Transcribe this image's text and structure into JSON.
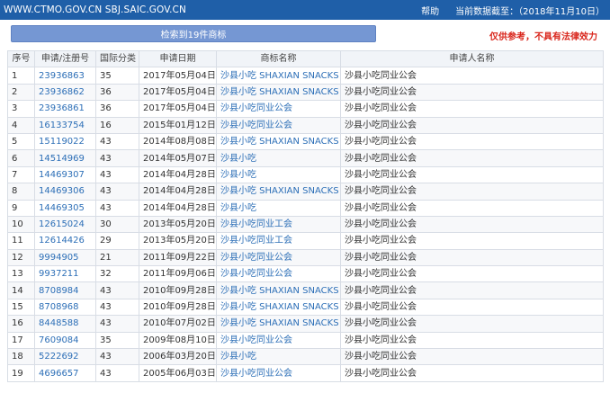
{
  "topbar": {
    "sites": "WWW.CTMO.GOV.CN SBJ.SAIC.GOV.CN",
    "help": "帮助",
    "data_date": "当前数据截至：（2018年11月10日）"
  },
  "toolbar": {
    "result_label": "检索到19件商标",
    "disclaimer": "仅供参考，不具有法律效力"
  },
  "table": {
    "headers": [
      "序号",
      "申请/注册号",
      "国际分类",
      "申请日期",
      "商标名称",
      "申请人名称"
    ],
    "rows": [
      {
        "idx": "1",
        "reg": "23936863",
        "cls": "35",
        "date": "2017年05月04日",
        "name": "沙县小吃 SHAXIAN SNACKS",
        "app": "沙县小吃同业公会"
      },
      {
        "idx": "2",
        "reg": "23936862",
        "cls": "36",
        "date": "2017年05月04日",
        "name": "沙县小吃 SHAXIAN SNACKS",
        "app": "沙县小吃同业公会"
      },
      {
        "idx": "3",
        "reg": "23936861",
        "cls": "36",
        "date": "2017年05月04日",
        "name": "沙县小吃同业公会",
        "app": "沙县小吃同业公会"
      },
      {
        "idx": "4",
        "reg": "16133754",
        "cls": "16",
        "date": "2015年01月12日",
        "name": "沙县小吃同业公会",
        "app": "沙县小吃同业公会"
      },
      {
        "idx": "5",
        "reg": "15119022",
        "cls": "43",
        "date": "2014年08月08日",
        "name": "沙县小吃 SHAXIAN SNACKS",
        "app": "沙县小吃同业公会"
      },
      {
        "idx": "6",
        "reg": "14514969",
        "cls": "43",
        "date": "2014年05月07日",
        "name": "沙县小吃",
        "app": "沙县小吃同业公会"
      },
      {
        "idx": "7",
        "reg": "14469307",
        "cls": "43",
        "date": "2014年04月28日",
        "name": "沙县小吃",
        "app": "沙县小吃同业公会"
      },
      {
        "idx": "8",
        "reg": "14469306",
        "cls": "43",
        "date": "2014年04月28日",
        "name": "沙县小吃 SHAXIAN SNACKS",
        "app": "沙县小吃同业公会"
      },
      {
        "idx": "9",
        "reg": "14469305",
        "cls": "43",
        "date": "2014年04月28日",
        "name": "沙县小吃",
        "app": "沙县小吃同业公会"
      },
      {
        "idx": "10",
        "reg": "12615024",
        "cls": "30",
        "date": "2013年05月20日",
        "name": "沙县小吃同业工会",
        "app": "沙县小吃同业公会"
      },
      {
        "idx": "11",
        "reg": "12614426",
        "cls": "29",
        "date": "2013年05月20日",
        "name": "沙县小吃同业工会",
        "app": "沙县小吃同业公会"
      },
      {
        "idx": "12",
        "reg": "9994905",
        "cls": "21",
        "date": "2011年09月22日",
        "name": "沙县小吃同业公会",
        "app": "沙县小吃同业公会"
      },
      {
        "idx": "13",
        "reg": "9937211",
        "cls": "32",
        "date": "2011年09月06日",
        "name": "沙县小吃同业公会",
        "app": "沙县小吃同业公会"
      },
      {
        "idx": "14",
        "reg": "8708984",
        "cls": "43",
        "date": "2010年09月28日",
        "name": "沙县小吃 SHAXIAN SNACKS",
        "app": "沙县小吃同业公会"
      },
      {
        "idx": "15",
        "reg": "8708968",
        "cls": "43",
        "date": "2010年09月28日",
        "name": "沙县小吃 SHAXIAN SNACKS",
        "app": "沙县小吃同业公会"
      },
      {
        "idx": "16",
        "reg": "8448588",
        "cls": "43",
        "date": "2010年07月02日",
        "name": "沙县小吃 SHAXIAN SNACKS",
        "app": "沙县小吃同业公会"
      },
      {
        "idx": "17",
        "reg": "7609084",
        "cls": "35",
        "date": "2009年08月10日",
        "name": "沙县小吃同业公会",
        "app": "沙县小吃同业公会"
      },
      {
        "idx": "18",
        "reg": "5222692",
        "cls": "43",
        "date": "2006年03月20日",
        "name": "沙县小吃",
        "app": "沙县小吃同业公会"
      },
      {
        "idx": "19",
        "reg": "4696657",
        "cls": "43",
        "date": "2005年06月03日",
        "name": "沙县小吃同业公会",
        "app": "沙县小吃同业公会"
      }
    ]
  }
}
